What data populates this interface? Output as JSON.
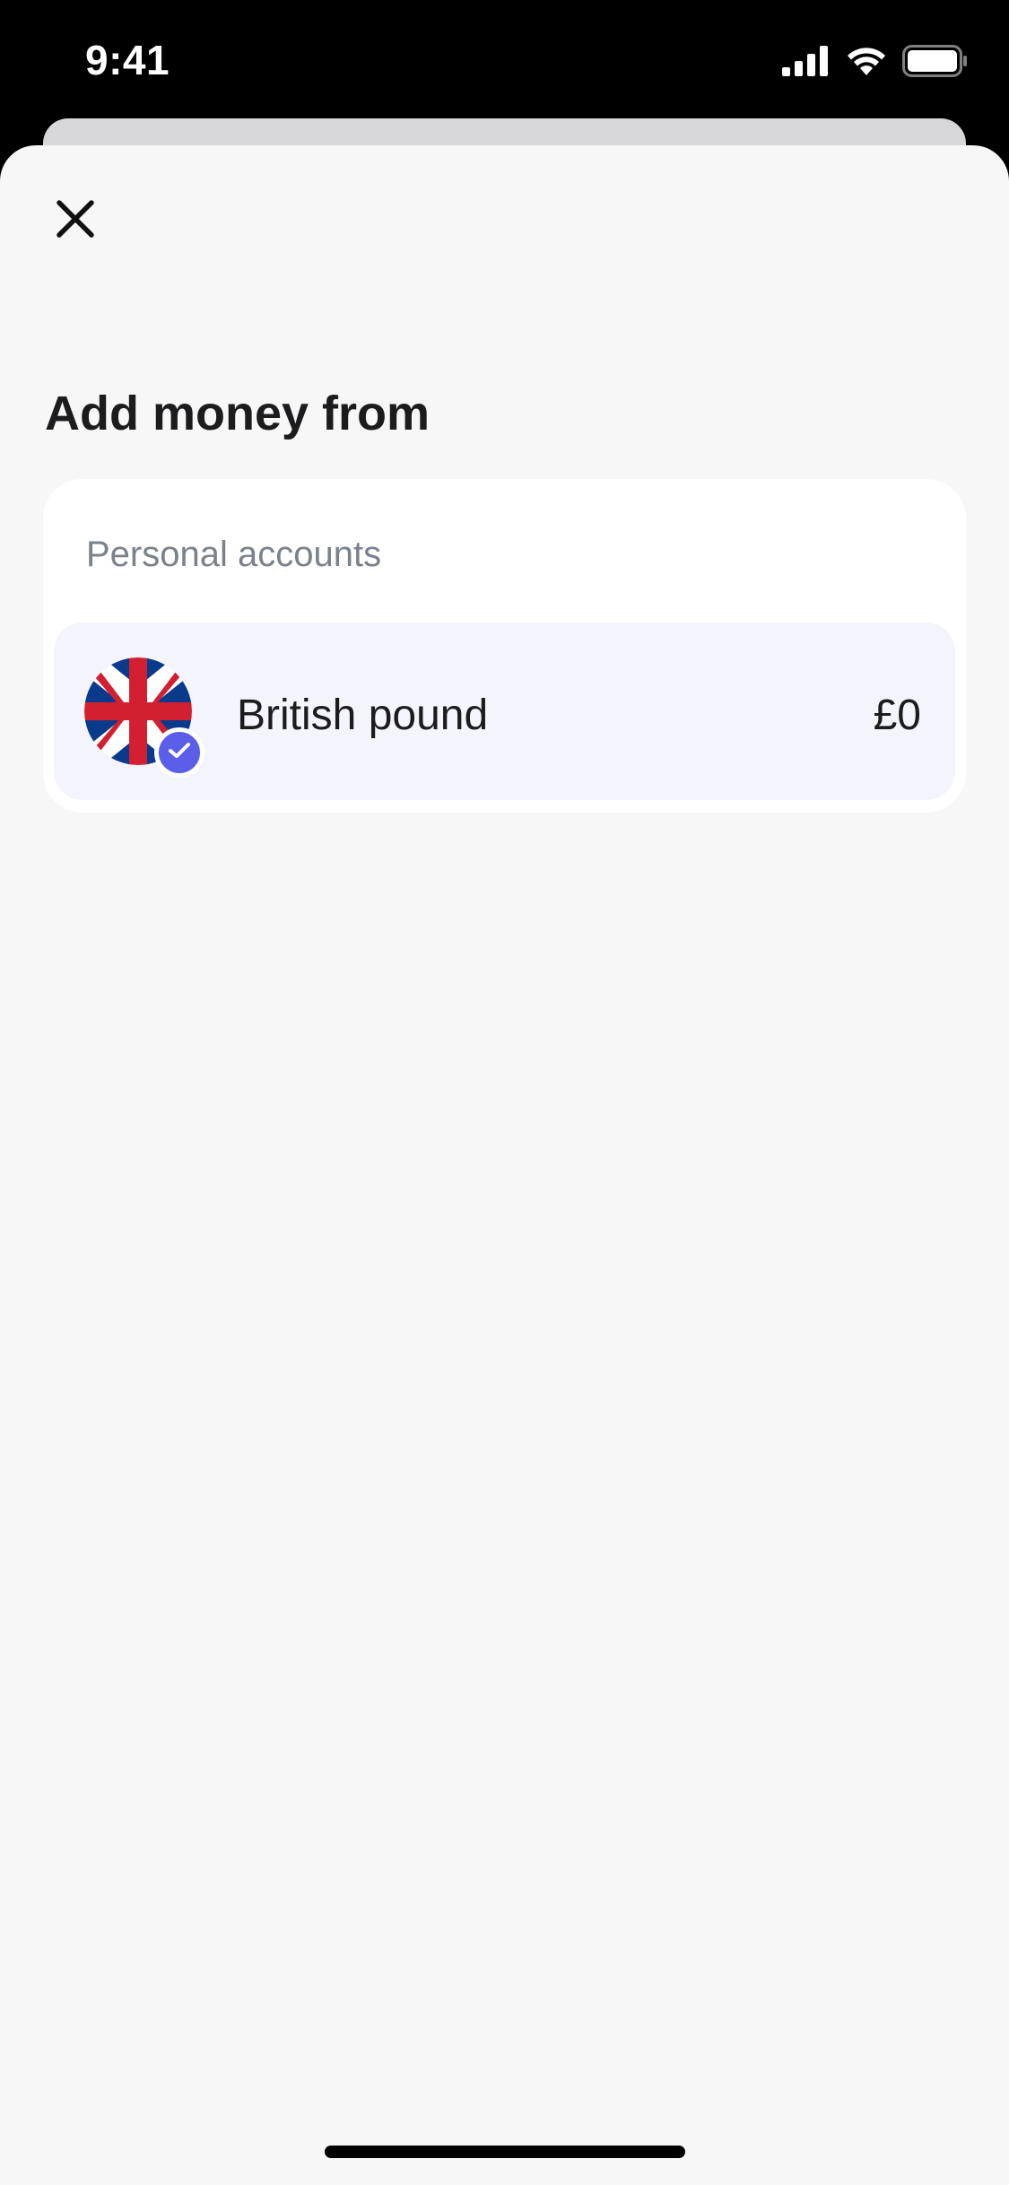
{
  "status_bar": {
    "time": "9:41",
    "icons": [
      "cellular-signal-icon",
      "wifi-icon",
      "battery-icon"
    ]
  },
  "header": {
    "close_icon": "close-icon"
  },
  "title": "Add money from",
  "accounts_section": {
    "label": "Personal accounts",
    "items": [
      {
        "name": "British pound",
        "balance": "£0",
        "flag_icon": "uk-flag-icon",
        "selected": true,
        "badge_icon": "check-icon"
      }
    ]
  },
  "colors": {
    "sheet_background": "#f7f7f8",
    "card_background": "#ffffff",
    "selected_row": "#f4f5fc",
    "accent": "#5a5ee8",
    "muted_text": "#7a828c",
    "primary_text": "#1c1c1e"
  }
}
